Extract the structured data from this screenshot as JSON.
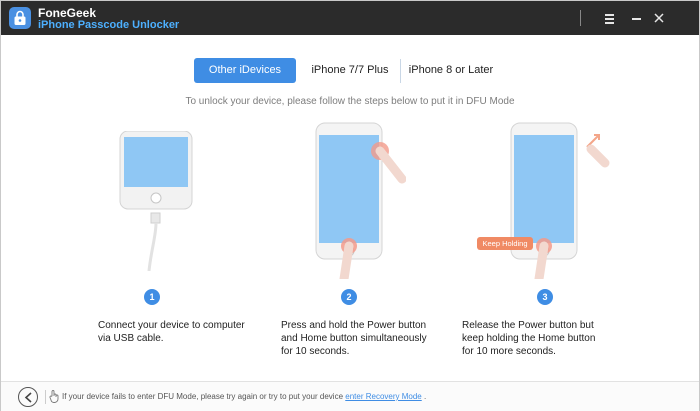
{
  "app": {
    "name": "FoneGeek",
    "subtitle": "iPhone Passcode Unlocker"
  },
  "titlebar": {
    "menu_icon": "hamburger-menu-icon",
    "minimize_icon": "minimize-icon",
    "close_icon": "close-icon"
  },
  "tabs": [
    {
      "label": "Other iDevices",
      "active": true
    },
    {
      "label": "iPhone 7/7 Plus",
      "active": false
    },
    {
      "label": "iPhone 8 or Later",
      "active": false
    }
  ],
  "instruction": "To unlock your device, please follow the steps below to put it in DFU Mode",
  "steps": [
    {
      "number": "1",
      "lines": [
        "Connect your device to computer",
        "via USB cable."
      ]
    },
    {
      "number": "2",
      "lines": [
        "Press and hold the Power button",
        "and Home button simultaneously",
        "for 10 seconds."
      ]
    },
    {
      "number": "3",
      "lines": [
        "Release the Power button but",
        "keep holding the Home button",
        "for 10 more seconds."
      ]
    }
  ],
  "keep_holding_label": "Keep Holding",
  "bottom": {
    "text": "If your device fails to enter DFU Mode, please try again or try to put your device",
    "link": "enter Recovery Mode",
    "suffix": "."
  },
  "colors": {
    "accent": "#3f8de4",
    "titlebar": "#2b2b2b",
    "subtitle": "#4db0ff",
    "badge": "#f08a64"
  }
}
